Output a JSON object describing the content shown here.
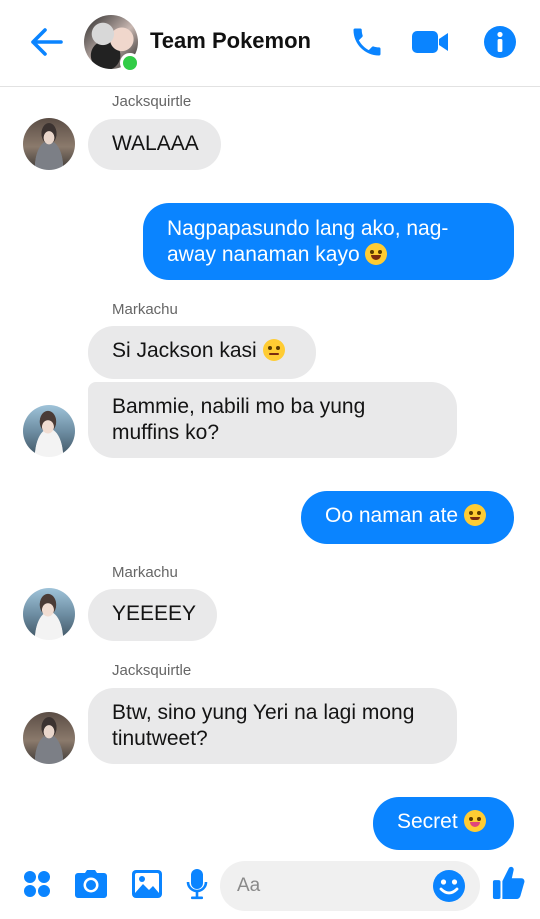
{
  "header": {
    "title": "Team Pokemon",
    "back_icon": "arrow-left-icon",
    "actions": [
      "phone-icon",
      "video-camera-icon",
      "info-icon"
    ],
    "accent_color": "#0a84ff",
    "online_status_color": "#31cc46"
  },
  "messages": [
    {
      "sender": "Jacksquirtle",
      "direction": "incoming",
      "text": "WALAAA"
    },
    {
      "direction": "outgoing",
      "text": "Nagpapasundo lang ako, nag-away nanaman kayo"
    },
    {
      "sender": "Markachu",
      "direction": "incoming",
      "text": "Si Jackson kasi"
    },
    {
      "direction": "incoming",
      "text": "Bammie, nabili mo ba yung muffins ko?"
    },
    {
      "direction": "outgoing",
      "text": "Oo naman ate"
    },
    {
      "sender": "Markachu",
      "direction": "incoming",
      "text": "YEEEEY"
    },
    {
      "sender": "Jacksquirtle",
      "direction": "incoming",
      "text": "Btw, sino yung Yeri na lagi mong tinutweet?"
    },
    {
      "direction": "outgoing",
      "text": "Secret"
    }
  ],
  "composer": {
    "placeholder": "Aa",
    "icons": [
      "apps-icon",
      "camera-icon",
      "gallery-icon",
      "microphone-icon",
      "emoji-icon",
      "thumbs-up-icon"
    ]
  },
  "colors": {
    "incoming_bubble": "#e9e9ea",
    "outgoing_bubble": "#0a84ff"
  }
}
